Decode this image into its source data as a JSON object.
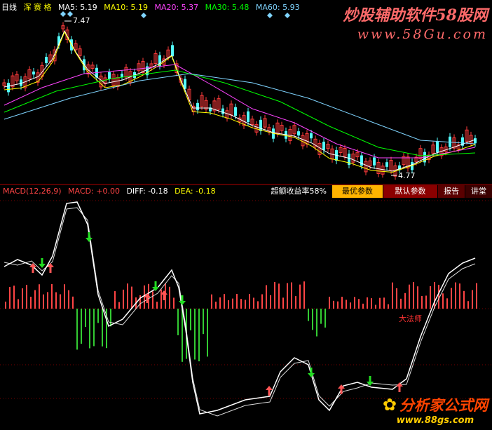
{
  "upper_panel": {
    "period_label": "日线",
    "stock_name": "浑 赛 格",
    "ma": [
      {
        "label": "MA5:",
        "value": "5.19",
        "color": "#ffffff"
      },
      {
        "label": "MA10:",
        "value": "5.19",
        "color": "#ffff00"
      },
      {
        "label": "MA20:",
        "value": "5.37",
        "color": "#ff44ff"
      },
      {
        "label": "MA30:",
        "value": "5.48",
        "color": "#00ff00"
      },
      {
        "label": "MA60:",
        "value": "5.93",
        "color": "#7fd4ff"
      }
    ],
    "high_marker": "7.47",
    "low_marker": "4.77"
  },
  "lower_panel": {
    "macd_title": "MACD(12,26,9)",
    "macd_label": "MACD:",
    "macd_value": "+0.00",
    "diff_label": "DIFF:",
    "diff_value": "-0.18",
    "dea_label": "DEA:",
    "dea_value": "-0.18",
    "annotation": "大法师"
  },
  "toolbar": {
    "excess_return": "超额收益率58%",
    "best_params": "最优参数",
    "default_params": "默认参数",
    "report": "报告",
    "lecture": "讲堂"
  },
  "watermark_top": {
    "title": "炒股辅助软件58股网",
    "url": "www.58Gu.com"
  },
  "watermark_bottom": {
    "title": "分析家公式网",
    "url": "www.88gs.com"
  },
  "colors": {
    "up": "#ff3b3b",
    "down": "#54ffff",
    "grid": "#7a0000",
    "macd_line": "#ffffff",
    "hist_pos": "#ff4444",
    "hist_neg": "#33cc33",
    "arrow_up": "#ff5555",
    "arrow_down": "#22dd22"
  }
}
